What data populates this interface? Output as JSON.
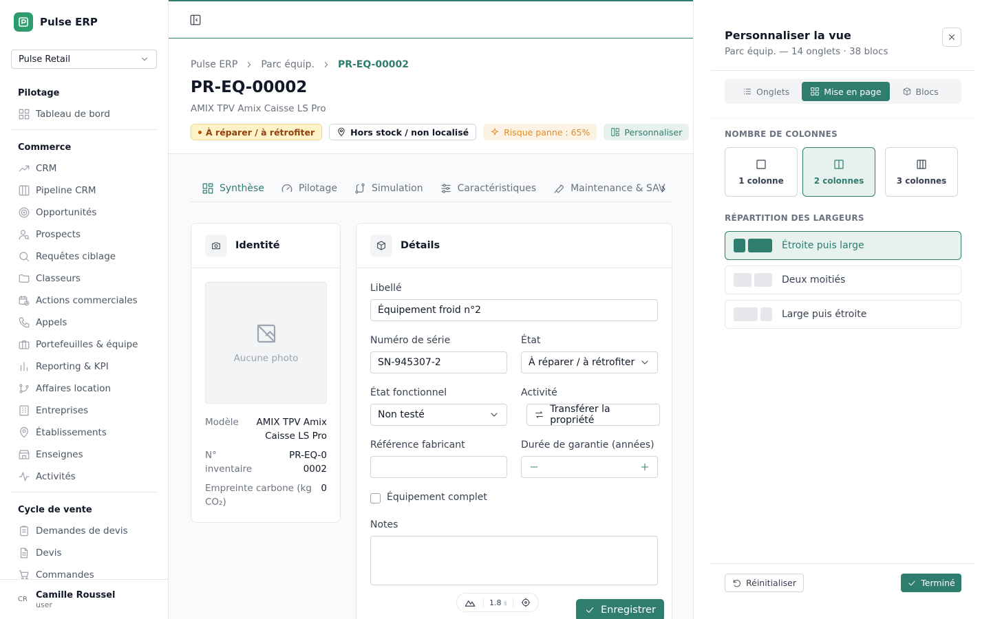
{
  "app": {
    "name": "Pulse ERP",
    "org": "Pulse Retail"
  },
  "nav": {
    "sections": [
      {
        "title": "Pilotage",
        "items": [
          {
            "label": "Tableau de bord",
            "icon": "dashboard-icon"
          }
        ]
      },
      {
        "title": "Commerce",
        "items": [
          {
            "label": "CRM",
            "icon": "trend-icon"
          },
          {
            "label": "Pipeline CRM",
            "icon": "columns-icon"
          },
          {
            "label": "Opportunités",
            "icon": "target-icon"
          },
          {
            "label": "Prospects",
            "icon": "user-search-icon"
          },
          {
            "label": "Requêtes ciblage",
            "icon": "search-icon"
          },
          {
            "label": "Classeurs",
            "icon": "folder-icon"
          },
          {
            "label": "Actions commerciales",
            "icon": "calendar-clock-icon"
          },
          {
            "label": "Appels",
            "icon": "phone-icon"
          },
          {
            "label": "Portefeuilles & équipe",
            "icon": "briefcase-icon"
          },
          {
            "label": "Reporting & KPI",
            "icon": "bar-chart-icon"
          },
          {
            "label": "Affaires location",
            "icon": "git-branch-icon"
          },
          {
            "label": "Entreprises",
            "icon": "building-icon"
          },
          {
            "label": "Établissements",
            "icon": "map-pin-icon"
          },
          {
            "label": "Enseignes",
            "icon": "store-icon"
          },
          {
            "label": "Activités",
            "icon": "activity-icon"
          }
        ]
      },
      {
        "title": "Cycle de vente",
        "items": [
          {
            "label": "Demandes de devis",
            "icon": "clipboard-icon"
          },
          {
            "label": "Devis",
            "icon": "file-text-icon"
          },
          {
            "label": "Commandes",
            "icon": "cart-icon"
          }
        ]
      }
    ]
  },
  "user": {
    "initials": "CR",
    "name": "Camille Roussel",
    "role": "user"
  },
  "breadcrumb": [
    "Pulse ERP",
    "Parc équip.",
    "PR-EQ-00002"
  ],
  "record": {
    "title": "PR-EQ-00002",
    "subtitle": "AMIX TPV Amix Caisse LS Pro",
    "badges": {
      "status": "À réparer / à rétrofiter",
      "stock": "Hors stock / non localisé",
      "risk": "Risque panne : 65%",
      "customize": "Personnaliser"
    }
  },
  "tabs": [
    "Synthèse",
    "Pilotage",
    "Simulation",
    "Caractéristiques",
    "Maintenance & SAV"
  ],
  "identity": {
    "title": "Identité",
    "no_photo": "Aucune photo",
    "model_label": "Modèle",
    "model_value": "AMIX TPV Amix Caisse LS Pro",
    "inventory_label": "N° inventaire",
    "inventory_value": "PR-EQ-00002",
    "carbon_label": "Empreinte carbone (kg CO₂)",
    "carbon_value": "0"
  },
  "details": {
    "title": "Détails",
    "libelle_label": "Libellé",
    "libelle_value": "Équipement froid n°2",
    "serial_label": "Numéro de série",
    "serial_value": "SN-945307-2",
    "state_label": "État",
    "state_value": "À réparer / à rétrofiter",
    "functional_label": "État fonctionnel",
    "functional_value": "Non testé",
    "activity_label": "Activité",
    "activity_button": "Transférer la propriété",
    "maker_ref_label": "Référence fabricant",
    "maker_ref_value": "",
    "warranty_label": "Durée de garantie (années)",
    "warranty_value": "",
    "complete_label": "Équipement complet",
    "complete_checked": false,
    "notes_label": "Notes",
    "notes_value": "",
    "save_label": "Enregistrer"
  },
  "perf": {
    "time": "1.8",
    "unit": "s"
  },
  "panel": {
    "title": "Personnaliser la vue",
    "subtitle": "Parc équip. — 14 onglets · 38 blocs",
    "segments": [
      "Onglets",
      "Mise en page",
      "Blocs"
    ],
    "active_segment": "Mise en page",
    "columns_title": "NOMBRE DE COLONNES",
    "columns": [
      "1 colonne",
      "2 colonnes",
      "3 colonnes"
    ],
    "active_columns": "2 colonnes",
    "widths_title": "RÉPARTITION DES LARGEURS",
    "widths": [
      "Étroite puis large",
      "Deux moitiés",
      "Large puis étroite"
    ],
    "active_width": "Étroite puis large",
    "reset_label": "Réinitialiser",
    "done_label": "Terminé"
  },
  "colors": {
    "accent": "#2f7d6e",
    "brand": "#2e9d6e",
    "warning": "#92400e",
    "risk": "#e08b24"
  }
}
